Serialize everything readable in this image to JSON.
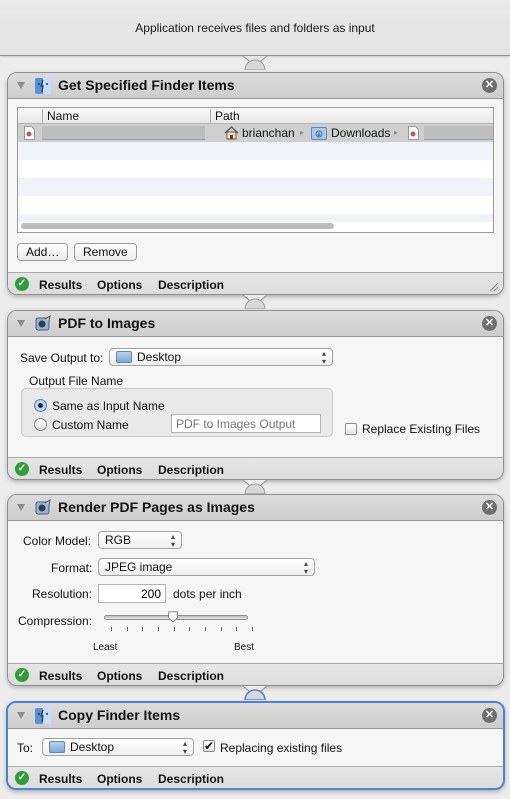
{
  "workflow": {
    "input_banner": "Application receives files and folders as input"
  },
  "actions": [
    {
      "title": "Get Specified Finder Items",
      "icon": "finder-icon",
      "table": {
        "columns": [
          "Name",
          "Path"
        ],
        "rows": [
          {
            "name": "",
            "path": [
              "brianchan",
              "Downloads",
              ""
            ]
          }
        ]
      },
      "buttons": {
        "add": "Add…",
        "remove": "Remove"
      },
      "footer": {
        "results": "Results",
        "options": "Options",
        "description": "Description"
      }
    },
    {
      "title": "PDF to Images",
      "icon": "automator-icon",
      "save_output_label": "Save Output to:",
      "save_output_value": "Desktop",
      "group_label": "Output File Name",
      "radio_same": "Same as Input Name",
      "radio_custom": "Custom Name",
      "radio_selected": "Same as Input Name",
      "custom_name_placeholder": "PDF to Images Output",
      "replace_label": "Replace Existing Files",
      "replace_checked": false,
      "footer": {
        "results": "Results",
        "options": "Options",
        "description": "Description"
      }
    },
    {
      "title": "Render PDF Pages as Images",
      "icon": "automator-icon",
      "color_model_label": "Color Model:",
      "color_model_value": "RGB",
      "format_label": "Format:",
      "format_value": "JPEG image",
      "resolution_label": "Resolution:",
      "resolution_value": "200",
      "resolution_unit": "dots per inch",
      "compression_label": "Compression:",
      "compression_min_label": "Least",
      "compression_max_label": "Best",
      "compression_value": 0.44,
      "compression_ticks": 10,
      "footer": {
        "results": "Results",
        "options": "Options",
        "description": "Description"
      }
    },
    {
      "title": "Copy Finder Items",
      "icon": "finder-icon",
      "to_label": "To:",
      "to_value": "Desktop",
      "replacing_label": "Replacing existing files",
      "replacing_checked": true,
      "selected": true,
      "footer": {
        "results": "Results",
        "options": "Options",
        "description": "Description"
      }
    }
  ],
  "glyphs": {
    "close": "✕",
    "check": "✓",
    "popup_arrows": "▴▾",
    "path_sep": "▸",
    "checkbox_on": "✔"
  },
  "colors": {
    "selected_border": "#4a82d8",
    "status_ok": "#2f9e3a"
  }
}
